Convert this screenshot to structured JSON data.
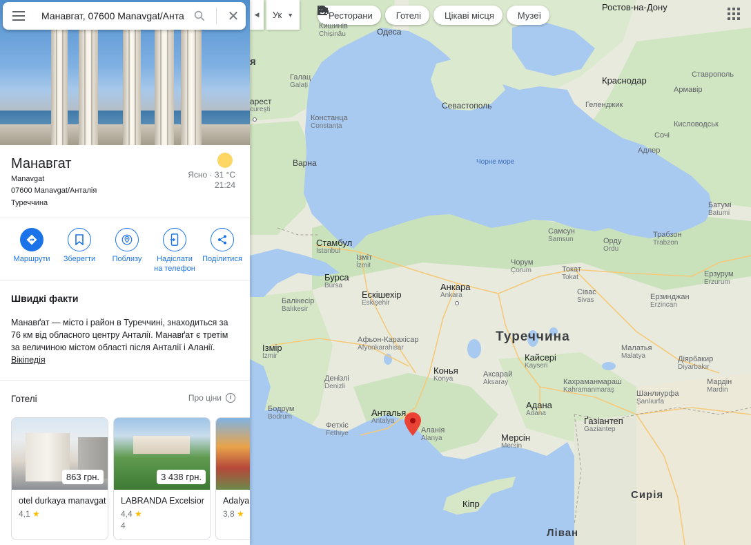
{
  "search": {
    "query": "Манавгат, 07600 Manavgat/Анта",
    "search_icon": "search-icon",
    "close_icon": "close-icon",
    "menu_icon": "hamburger-menu-icon"
  },
  "place": {
    "title": "Манавгат",
    "latin": "Manavgat",
    "address": "07600 Manavgat/Анталія",
    "country": "Туреччина",
    "weather": {
      "condition": "Ясно",
      "temp": "31 °C",
      "time": "21:24",
      "separator": "·"
    }
  },
  "actions": [
    {
      "label": "Маршрути",
      "icon": "directions-icon"
    },
    {
      "label": "Зберегти",
      "icon": "bookmark-icon"
    },
    {
      "label": "Поблизу",
      "icon": "nearby-icon"
    },
    {
      "label": "Надіслати на телефон",
      "icon": "send-to-phone-icon"
    },
    {
      "label": "Поділитися",
      "icon": "share-icon"
    }
  ],
  "facts": {
    "heading": "Швидкі факти",
    "text": "Манавґат — місто і район в Туреччині, знаходиться за 76 км від обласного центру Анталії. Манавґат є третім за величиною містом області після Анталії і Аланії.",
    "link": "Вікіпедія"
  },
  "hotels": {
    "heading": "Готелі",
    "prices_label": "Про ціни",
    "items": [
      {
        "name": "otel durkaya manavgat",
        "price": "863 грн.",
        "rating": "4,1",
        "reviews": ""
      },
      {
        "name": "LABRANDA Excelsior",
        "price": "3 438 грн.",
        "rating": "4,4",
        "reviews": "4"
      },
      {
        "name": "Adalya",
        "price": "",
        "rating": "3,8",
        "reviews": ""
      }
    ]
  },
  "map": {
    "lang_button": "Ук",
    "chips": [
      {
        "label": "Ресторани",
        "icon": "fork-knife-icon"
      },
      {
        "label": "Готелі",
        "icon": "bed-icon"
      },
      {
        "label": "Цікаві місця",
        "icon": "camera-icon"
      },
      {
        "label": "Музеї",
        "icon": "museum-icon"
      }
    ],
    "labels": {
      "rostov": "Ростов-на-Дону",
      "kishinev": "Кишинів",
      "chisinau": "Chișinău",
      "odesa": "Одеса",
      "moldova_frag": "я",
      "galac": "Галац",
      "galati": "Galați",
      "bucharest_frag": "арест",
      "bucuresti_frag": "curești",
      "constanta": "Констанца",
      "constanta_l": "Constanța",
      "varna": "Варна",
      "sevastopol": "Севастополь",
      "krasnodar": "Краснодар",
      "stavropol": "Ставрополь",
      "armavir": "Армавір",
      "gelendzhik": "Геленджик",
      "sochi": "Сочі",
      "kislovodsk": "Кисловодськ",
      "adler": "Адлер",
      "black_sea": "Чорне море",
      "batumi": "Батумі",
      "batumi_l": "Batumi",
      "trabzon": "Трабзон",
      "trabzon_l": "Trabzon",
      "samsun": "Самсун",
      "samsun_l": "Samsun",
      "ordu": "Орду",
      "ordu_l": "Ordu",
      "istanbul": "Стамбул",
      "istanbul_l": "İstanbul",
      "izmit": "Ізміт",
      "izmit_l": "İzmit",
      "bursa": "Бурса",
      "bursa_l": "Bursa",
      "eskisehir": "Ескішехір",
      "eskisehir_l": "Eskişehir",
      "ankara": "Анкара",
      "ankara_l": "Ankara",
      "corum": "Чорум",
      "corum_l": "Çorum",
      "tokat": "Токат",
      "tokat_l": "Tokat",
      "sivas": "Сівас",
      "sivas_l": "Sivas",
      "erzurum": "Ерзурум",
      "erzurum_l": "Erzurum",
      "erzincan": "Ерзинджан",
      "erzincan_l": "Erzincan",
      "balikesir": "Балікесір",
      "balikesir_l": "Balıkesir",
      "izmir": "Ізмір",
      "izmir_l": "İzmir",
      "afyon": "Афьон-Карахісар",
      "afyon_l": "Afyonkarahisar",
      "turkey": "Туреччина",
      "kayseri": "Кайсері",
      "kayseri_l": "Kayseri",
      "konya": "Конья",
      "konya_l": "Konya",
      "aksaray": "Аксарай",
      "aksaray_l": "Aksaray",
      "malatya": "Малатья",
      "malatya_l": "Malatya",
      "diyarbakir": "Діярбакир",
      "diyarbakir_l": "Diyarbakır",
      "denizli": "Денізлі",
      "denizli_l": "Denizli",
      "kahramanmaras": "Кахраманмараш",
      "kahramanmaras_l": "Kahramanmaraş",
      "sanliurfa": "Шанлиурфа",
      "sanliurfa_l": "Şanlıurfa",
      "mardin": "Мардін",
      "mardin_l": "Mardin",
      "bodrum": "Бодрум",
      "bodrum_l": "Bodrum",
      "fethiye": "Фетхіє",
      "fethiye_l": "Fethiye",
      "antalya": "Анталья",
      "antalya_l": "Antalya",
      "alanya": "Аланія",
      "alanya_l": "Alanya",
      "adana": "Адана",
      "adana_l": "Adana",
      "mersin": "Мерсін",
      "mersin_l": "Mersin",
      "gaziantep": "Ґазіантеп",
      "gaziantep_l": "Gaziantep",
      "syria": "Сирія",
      "cyprus": "Кіпр",
      "lebanon": "Ліван"
    }
  },
  "colors": {
    "accent": "#1a73e8",
    "sea": "#a8c9f0",
    "land": "#e8eadd",
    "green": "#cce6c2",
    "pin": "#ea4335"
  }
}
